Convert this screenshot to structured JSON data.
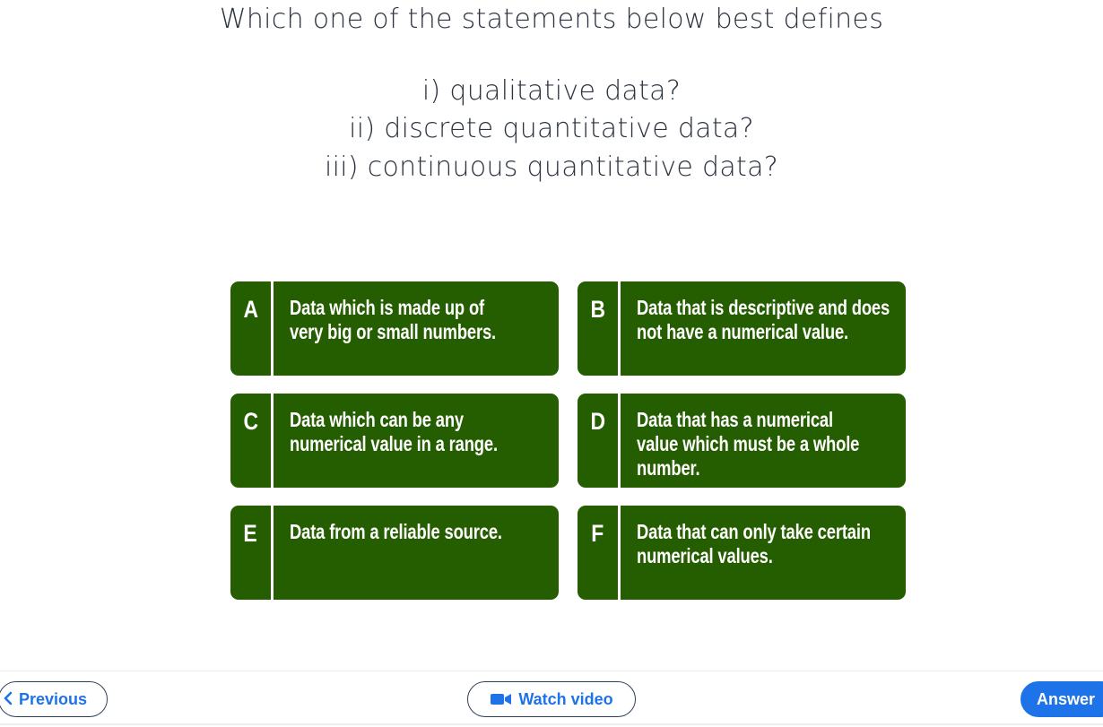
{
  "question": {
    "intro": "Which one of the statements below best defines",
    "parts": [
      "i) qualitative data?",
      "ii) discrete quantitative data?",
      "iii) continuous quantitative data?"
    ]
  },
  "options": [
    {
      "letter": "A",
      "lines": [
        "Data which is made up of",
        "very big or small numbers."
      ]
    },
    {
      "letter": "B",
      "lines": [
        "Data that is descriptive and does",
        "not have a numerical value."
      ]
    },
    {
      "letter": "C",
      "lines": [
        "Data which can be any",
        "numerical value in a range."
      ]
    },
    {
      "letter": "D",
      "lines": [
        "Data that has a numerical",
        "value which must be a whole",
        "number."
      ]
    },
    {
      "letter": "E",
      "lines": [
        "Data from a reliable source."
      ]
    },
    {
      "letter": "F",
      "lines": [
        "Data that can only take certain",
        "numerical values."
      ]
    }
  ],
  "nav": {
    "previous_label": "Previous",
    "video_label": "Watch video",
    "answer_label": "Answer"
  },
  "colors": {
    "card_bg": "#255e00",
    "accent_blue": "#1e73e8",
    "text_dark": "#2b3340"
  },
  "icons": {
    "previous": "chevron-left-icon",
    "video": "video-camera-icon"
  }
}
